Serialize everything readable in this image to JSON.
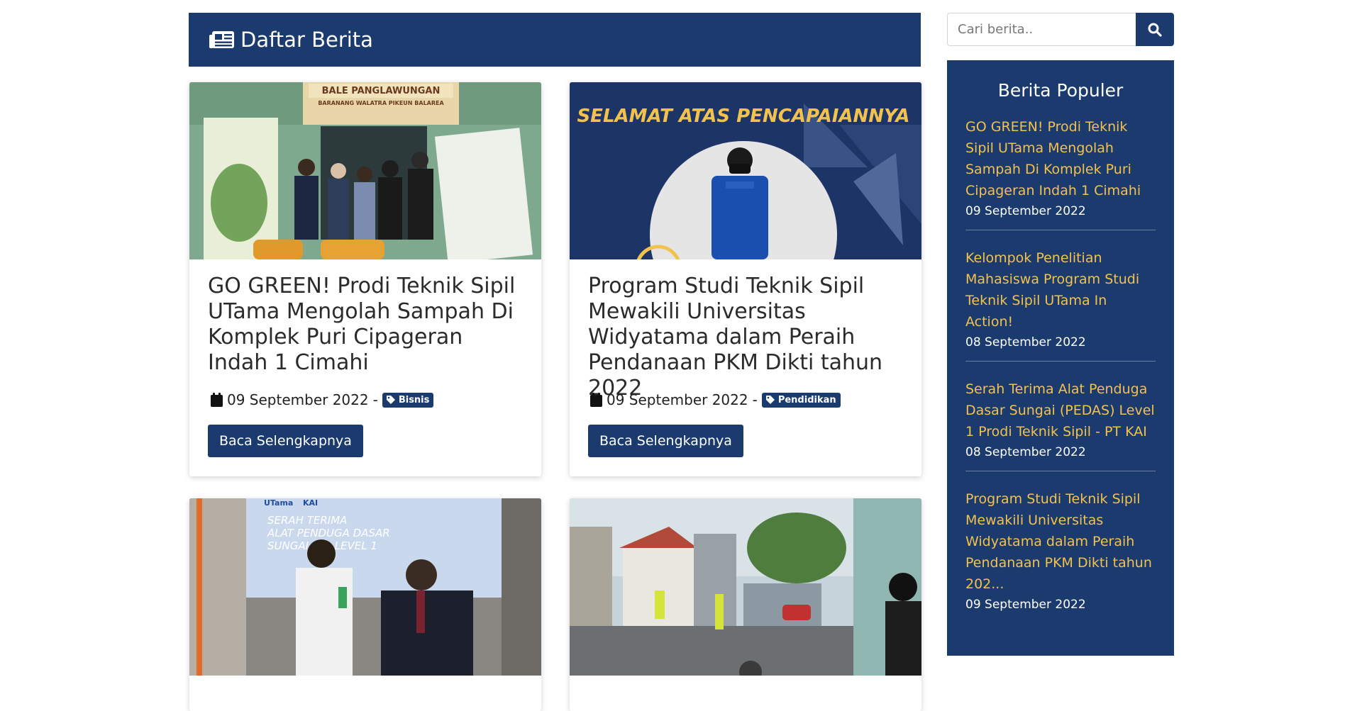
{
  "header": {
    "title": "Daftar Berita",
    "icon": "newspaper-icon"
  },
  "search": {
    "placeholder": "Cari berita..",
    "button_icon": "search-icon"
  },
  "posts": [
    {
      "title": "GO GREEN! Prodi Teknik Sipil UTama Mengolah Sampah Di Komplek Puri Cipageran Indah 1 Cimahi",
      "date": "09 September 2022",
      "separator": "-",
      "category": "Bisnis",
      "read_more": "Baca Selengkapnya",
      "image_text_1": "BALE PANGLAWUNGAN",
      "image_text_2": "BARANANG WALATRA PIKEUN BALAREA"
    },
    {
      "title": "Program Studi Teknik Sipil Mewakili Universitas Widyatama dalam Peraih Pendanaan PKM Dikti tahun 2022",
      "date": "09 September 2022",
      "separator": "-",
      "category": "Pendidikan",
      "read_more": "Baca Selengkapnya",
      "image_text_1": "SELAMAT ATAS PENCAPAIANNYA"
    },
    {
      "image_text_1": "SERAH TERIMA",
      "image_text_2": "ALAT PENDUGA DASAR",
      "image_text_3": "SUNGAI (P... LEVEL 1",
      "image_text_4": "UTama",
      "image_text_5": "KAI"
    },
    {}
  ],
  "sidebar": {
    "title": "Berita Populer",
    "items": [
      {
        "title": "GO GREEN! Prodi Teknik Sipil UTama Mengolah Sampah Di Komplek Puri Cipageran Indah 1 Cimahi",
        "date": "09 September 2022"
      },
      {
        "title": "Kelompok Penelitian Mahasiswa Program Studi Teknik Sipil UTama In Action!",
        "date": "08 September 2022"
      },
      {
        "title": "Serah Terima Alat Penduga Dasar Sungai (PEDAS) Level 1 Prodi Teknik Sipil - PT KAI",
        "date": "08 September 2022"
      },
      {
        "title": "Program Studi Teknik Sipil Mewakili Universitas Widyatama dalam Peraih Pendanaan PKM Dikti tahun 202...",
        "date": "09 September 2022"
      }
    ]
  },
  "colors": {
    "primary": "#1b3a6e",
    "accent": "#f2c14e",
    "white": "#ffffff"
  }
}
